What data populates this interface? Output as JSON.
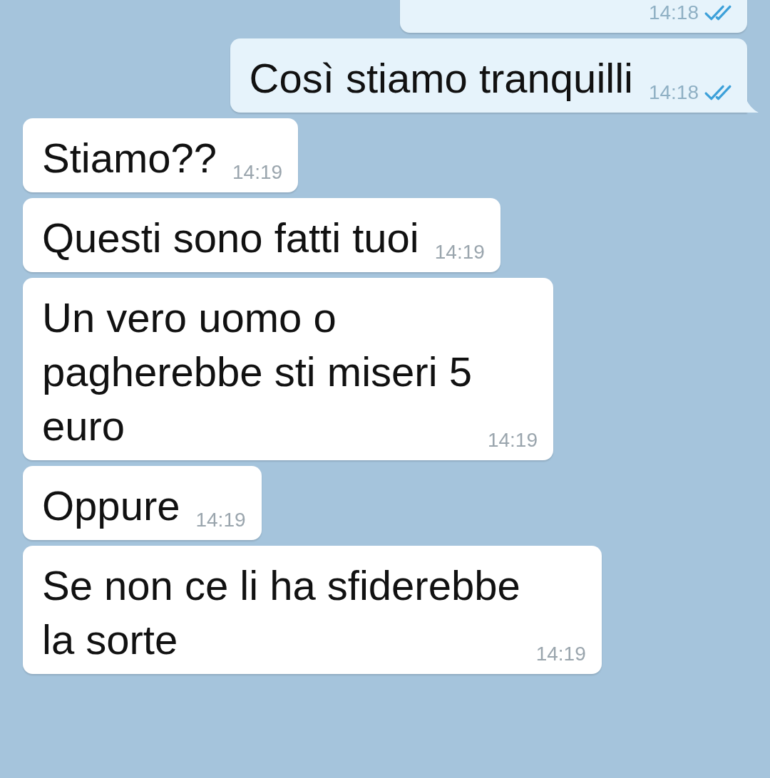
{
  "messages": [
    {
      "kind": "outgoing",
      "time": "14:18",
      "read": true,
      "tail": false
    },
    {
      "kind": "outgoing",
      "text": "Così stiamo tranquilli",
      "time": "14:18",
      "read": true,
      "tail": true
    },
    {
      "kind": "incoming",
      "text": "Stiamo??",
      "time": "14:19"
    },
    {
      "kind": "incoming",
      "text": "Questi sono fatti tuoi",
      "time": "14:19"
    },
    {
      "kind": "incoming",
      "text": "Un vero uomo o\npagherebbe sti miseri 5\neuro",
      "time": "14:19"
    },
    {
      "kind": "incoming",
      "text": "Oppure",
      "time": "14:19"
    },
    {
      "kind": "incoming",
      "text": "Se non ce li ha sfiderebbe\nla sorte",
      "time": "14:19"
    }
  ]
}
